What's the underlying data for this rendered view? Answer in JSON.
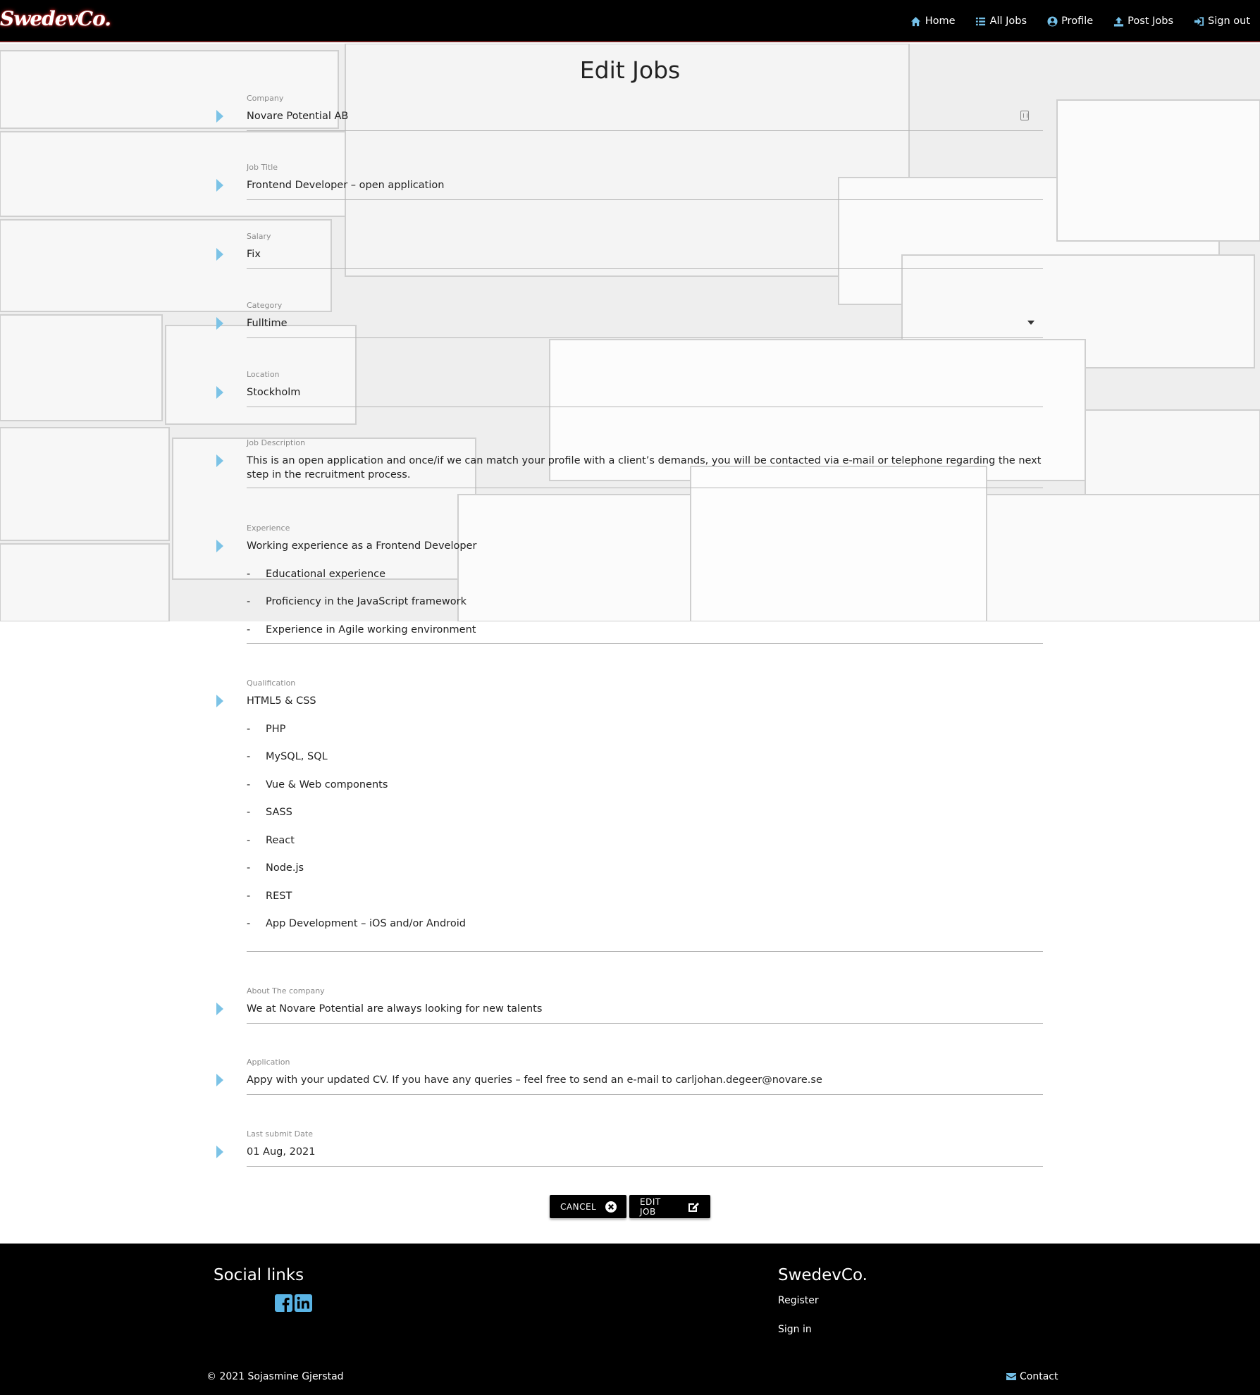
{
  "navbar": {
    "brand": "SwedevCo.",
    "items": [
      {
        "label": "Home",
        "icon": "home-icon"
      },
      {
        "label": "All Jobs",
        "icon": "list-icon"
      },
      {
        "label": "Profile",
        "icon": "user-circle-icon"
      },
      {
        "label": "Post Jobs",
        "icon": "upload-icon"
      },
      {
        "label": "Sign out",
        "icon": "sign-out-icon"
      }
    ]
  },
  "page": {
    "title": "Edit Jobs"
  },
  "form": {
    "company": {
      "label": "Company",
      "value": "Novare Potential AB"
    },
    "job_title": {
      "label": "Job Title",
      "value": "Frontend Developer – open application"
    },
    "salary": {
      "label": "Salary",
      "value": "Fix"
    },
    "category": {
      "label": "Category",
      "value": "Fulltime"
    },
    "location": {
      "label": "Location",
      "value": "Stockholm"
    },
    "description": {
      "label": "Job Description",
      "value": "This is an open application and once/if we can match your profile with a client’s demands, you will be contacted via e-mail or telephone regarding the next step in the recruitment process."
    },
    "experience": {
      "label": "Experience",
      "first": "Working experience as a Frontend Developer",
      "dash": "-",
      "items": [
        "Educational experience",
        "Proficiency in the JavaScript framework",
        "Experience in Agile working environment"
      ]
    },
    "qualification": {
      "label": "Qualification",
      "first": "HTML5 & CSS",
      "dash": "-",
      "items": [
        "PHP",
        "MySQL, SQL",
        "Vue & Web components",
        "SASS",
        "React",
        "Node.js",
        "REST",
        "App Development – iOS and/or Android"
      ]
    },
    "about": {
      "label": "About The company",
      "value": "We at Novare Potential are always looking for new talents"
    },
    "application": {
      "label": "Application",
      "value": "Appy with your updated CV. If you have any queries – feel free to send an e-mail to carljohan.degeer@novare.se"
    },
    "last_date": {
      "label": "Last submit Date",
      "value": "01 Aug, 2021"
    }
  },
  "buttons": {
    "cancel": "CANCEL",
    "edit": "EDIT JOB"
  },
  "footer": {
    "social_title": "Social links",
    "brand_title": "SwedevCo.",
    "links": [
      "Register",
      "Sign in"
    ],
    "copyright": "© 2021 Sojasmine Gjerstad",
    "contact": "Contact"
  },
  "colors": {
    "accent": "#74c0e8",
    "navbar": "#000000",
    "footer": "#000000"
  }
}
